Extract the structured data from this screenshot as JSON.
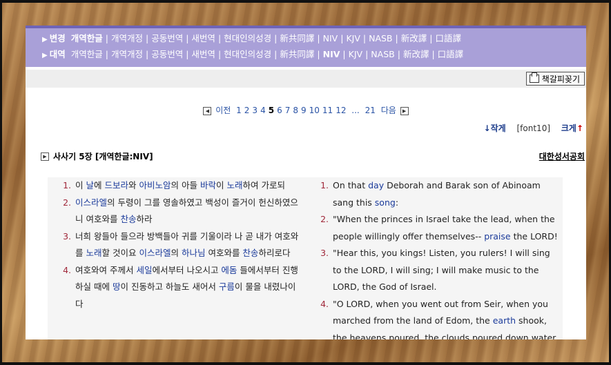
{
  "versions": {
    "row1": {
      "label": "변경",
      "items": [
        "개역한글",
        "개역개정",
        "공동번역",
        "새번역",
        "현대인의성경",
        "新共同譯",
        "NIV",
        "KJV",
        "NASB",
        "新改譯",
        "口語譯"
      ],
      "active_index": 0
    },
    "row2": {
      "label": "대역",
      "items": [
        "개역한글",
        "개역개정",
        "공동번역",
        "새번역",
        "현대인의성경",
        "新共同譯",
        "NIV",
        "KJV",
        "NASB",
        "新改譯",
        "口語譯"
      ],
      "active_index": 6
    }
  },
  "toolbar": {
    "bookmark_label": "책갈피꽂기"
  },
  "pager": {
    "prev": "이전",
    "next": "다음",
    "pages": [
      "1",
      "2",
      "3",
      "4",
      "5",
      "6",
      "7",
      "8",
      "9",
      "10",
      "11",
      "12"
    ],
    "current": "5",
    "ellipsis": "...",
    "last": "21"
  },
  "font": {
    "smaller": "작게",
    "current": "[font10]",
    "bigger": "크게",
    "down_arrow": "↓",
    "up_arrow": "↑"
  },
  "chapter": {
    "title": "사사기 5장 [개역한글:NIV]",
    "publisher": "대한성서공회"
  },
  "korean_verses": [
    {
      "n": "1.",
      "parts": [
        [
          "이 ",
          0
        ],
        [
          "날",
          1
        ],
        [
          "에 ",
          0
        ],
        [
          "드보라",
          1
        ],
        [
          "와 ",
          0
        ],
        [
          "아비노암",
          1
        ],
        [
          "의 아들 ",
          0
        ],
        [
          "바락",
          1
        ],
        [
          "이 ",
          0
        ],
        [
          "노래",
          1
        ],
        [
          "하여 가로되",
          0
        ]
      ]
    },
    {
      "n": "2.",
      "parts": [
        [
          "이스라엘",
          1
        ],
        [
          "의 두령이 그를 영솔하였고 백성이 즐거이 헌신하였으니 여호와를 ",
          0
        ],
        [
          "찬송",
          1
        ],
        [
          "하라",
          0
        ]
      ]
    },
    {
      "n": "3.",
      "parts": [
        [
          "너희 왕들아 들으라 방백들아 귀를 기울이라 나 곧 내가 여호와를 ",
          0
        ],
        [
          "노래",
          1
        ],
        [
          "할 것이요 ",
          0
        ],
        [
          "이스라엘",
          1
        ],
        [
          "의 ",
          0
        ],
        [
          "하나님",
          1
        ],
        [
          " 여호와를 ",
          0
        ],
        [
          "찬송",
          1
        ],
        [
          "하리로다",
          0
        ]
      ]
    },
    {
      "n": "4.",
      "parts": [
        [
          "여호와여 주께서 ",
          0
        ],
        [
          "세일",
          1
        ],
        [
          "에서부터 나오시고 ",
          0
        ],
        [
          "에돔",
          1
        ],
        [
          " 들에서부터 진행하실 때에 ",
          0
        ],
        [
          "땅",
          1
        ],
        [
          "이 진동하고 하늘도 새어서 ",
          0
        ],
        [
          "구름",
          1
        ],
        [
          "이 물을 내렸나이다",
          0
        ]
      ]
    }
  ],
  "english_verses": [
    {
      "n": "1.",
      "parts": [
        [
          "On that ",
          0
        ],
        [
          "day",
          1
        ],
        [
          " Deborah and Barak son of Abinoam sang this ",
          0
        ],
        [
          "song",
          1
        ],
        [
          ":",
          0
        ]
      ]
    },
    {
      "n": "2.",
      "parts": [
        [
          "\"When the princes in Israel take the lead, when the people willingly offer themselves-- ",
          0
        ],
        [
          "praise",
          1
        ],
        [
          " the LORD!",
          0
        ]
      ]
    },
    {
      "n": "3.",
      "parts": [
        [
          "\"Hear this, you kings! Listen, you rulers! I will sing to the LORD, I will sing; I will make music to the LORD, the God of Israel.",
          0
        ]
      ]
    },
    {
      "n": "4.",
      "parts": [
        [
          "\"O LORD, when you went out from Seir, when you marched from the land of Edom, the ",
          0
        ],
        [
          "earth",
          1
        ],
        [
          " shook, the heavens poured, the clouds poured down water.",
          0
        ]
      ]
    }
  ]
}
